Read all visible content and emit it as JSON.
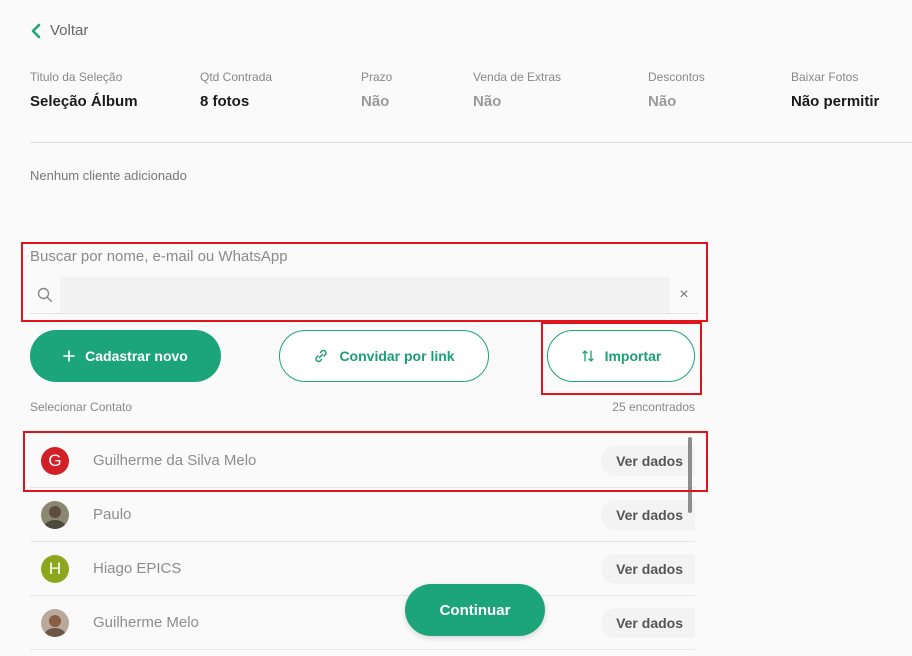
{
  "back": {
    "label": "Voltar"
  },
  "info": [
    {
      "label": "Titulo da Seleção",
      "value": "Seleção Álbum",
      "muted": false
    },
    {
      "label": "Qtd Contrada",
      "value": "8 fotos",
      "muted": false
    },
    {
      "label": "Prazo",
      "value": "Não",
      "muted": true
    },
    {
      "label": "Venda de Extras",
      "value": "Não",
      "muted": true
    },
    {
      "label": "Descontos",
      "value": "Não",
      "muted": true
    },
    {
      "label": "Baixar Fotos",
      "value": "Não permitir",
      "muted": false
    }
  ],
  "no_client_text": "Nenhum cliente adicionado",
  "search": {
    "label": "Buscar por nome, e-mail ou WhatsApp",
    "value": "",
    "clear": "×"
  },
  "actions": {
    "new_label": "Cadastrar novo",
    "invite_label": "Convidar por link",
    "import_label": "Importar"
  },
  "contacts_header": {
    "label": "Selecionar Contato",
    "count": "25 encontrados"
  },
  "contacts": [
    {
      "name": "Guilherme da Silva Melo",
      "initial": "G",
      "avatar_color": "#d32027",
      "photo": false,
      "action": "Ver dados"
    },
    {
      "name": "Paulo",
      "initial": "",
      "avatar_color": "#6b6a55",
      "photo": true,
      "action": "Ver dados"
    },
    {
      "name": "Hiago EPICS",
      "initial": "H",
      "avatar_color": "#8da61b",
      "photo": false,
      "action": "Ver dados"
    },
    {
      "name": "Guilherme Melo",
      "initial": "",
      "avatar_color": "#7a6a60",
      "photo": true,
      "action": "Ver dados"
    }
  ],
  "continue_label": "Continuar",
  "colors": {
    "accent": "#1da57a",
    "highlight": "#e0141b"
  }
}
